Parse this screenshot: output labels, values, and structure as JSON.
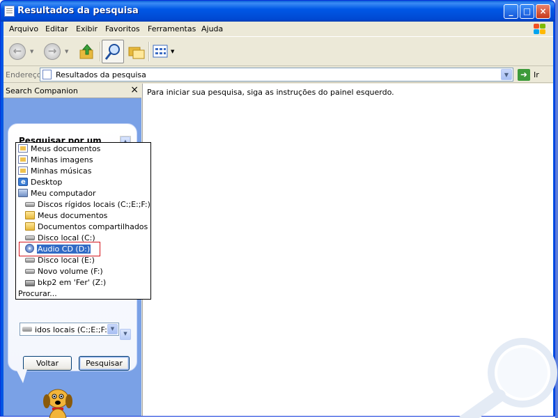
{
  "window": {
    "title": "Resultados da pesquisa",
    "controls": {
      "minimize": "_",
      "maximize": "□",
      "close": "×"
    }
  },
  "menubar": {
    "items": [
      "Arquivo",
      "Editar",
      "Exibir",
      "Favoritos",
      "Ferramentas",
      "Ajuda"
    ]
  },
  "toolbar": {
    "back_icon": "back-arrow-icon",
    "forward_icon": "forward-arrow-icon",
    "up_icon": "up-folder-icon",
    "search_icon": "search-icon",
    "folders_icon": "folders-icon",
    "views_icon": "views-icon"
  },
  "addressbar": {
    "label": "Endereço",
    "value": "Resultados da pesquisa",
    "go_label": "Ir"
  },
  "left_pane": {
    "title": "Search Companion",
    "close": "×",
    "question": "Pesquisar por um dos critérios abaixo ou todos eles.",
    "dropdown_items": [
      {
        "label": "Meus documentos",
        "icon": "my-documents-icon"
      },
      {
        "label": "Minhas imagens",
        "icon": "my-pictures-icon"
      },
      {
        "label": "Minhas músicas",
        "icon": "my-music-icon"
      },
      {
        "label": "Desktop",
        "icon": "desktop-icon"
      },
      {
        "label": "Meu computador",
        "icon": "my-computer-icon"
      },
      {
        "label": "Discos rígidos locais (C:;E:;F:)",
        "icon": "hard-drive-icon"
      },
      {
        "label": "Meus documentos",
        "icon": "folder-icon"
      },
      {
        "label": "Documentos compartilhados",
        "icon": "folder-icon"
      },
      {
        "label": "Disco local (C:)",
        "icon": "hard-drive-icon"
      },
      {
        "label": "Audio CD (D:)",
        "icon": "cd-drive-icon",
        "selected": true
      },
      {
        "label": "Disco local (E:)",
        "icon": "hard-drive-icon"
      },
      {
        "label": "Novo volume (F:)",
        "icon": "hard-drive-icon"
      },
      {
        "label": "bkp2 em 'Fer' (Z:)",
        "icon": "network-drive-icon"
      },
      {
        "label": "Procurar...",
        "icon": ""
      }
    ],
    "combo_value": "idos locais (C:;E:;F:)",
    "back_button": "Voltar",
    "search_button": "Pesquisar"
  },
  "right_pane": {
    "message": "Para iniciar sua pesquisa, siga as instruções do painel esquerdo."
  },
  "colors": {
    "title_bar": "#0058e6",
    "pane_blue": "#7aa1e6",
    "selection": "#316ac5",
    "highlight_box": "#d4131b"
  }
}
